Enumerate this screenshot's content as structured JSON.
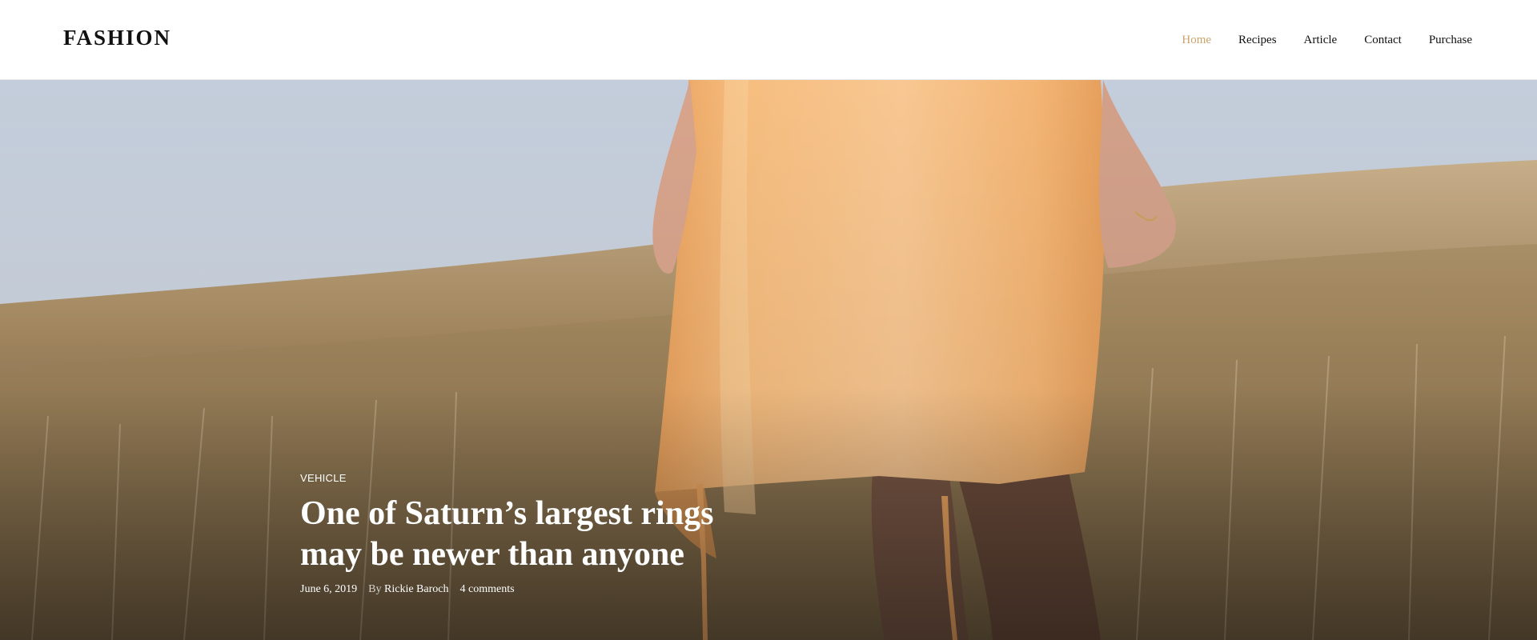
{
  "brand": {
    "logo": "FASHION"
  },
  "nav": {
    "items": [
      "Home",
      "Recipes",
      "Article",
      "Contact",
      "Purchase"
    ],
    "active": "Home"
  },
  "colors": {
    "accent": "#c9a36a",
    "text": "#111111",
    "hero_text": "#ffffff"
  },
  "hero": {
    "category": "VEHICLE",
    "title_line1": "One of Saturn’s largest rings",
    "title_line2": "may be newer than anyone",
    "date": "June 6, 2019",
    "by_label": "By",
    "author": "Rickie Baroch",
    "comments": "4 comments"
  }
}
